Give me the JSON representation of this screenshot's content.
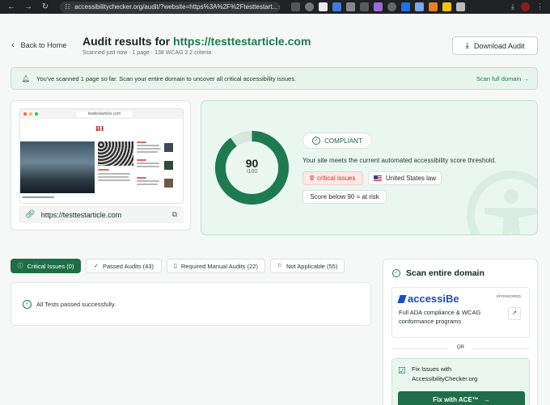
{
  "browser": {
    "url": "accessibilitychecker.org/audit/?website=https%3A%2F%2Ftesttestart..."
  },
  "header": {
    "back_label": "Back to Home",
    "title_prefix": "Audit results for ",
    "title_site": "https://testtestarticle.com",
    "subtitle": "Scanned just now · 1 page · 138 WCAG 2.2 criteria",
    "download_label": "Download Audit"
  },
  "banner": {
    "text": "You've scanned 1 page so far. Scan your entire domain to uncover all critical accessibility issues.",
    "link": "Scan full domain →"
  },
  "preview": {
    "mini_url": "testtestarticle.com",
    "link": "https://testtestarticle.com"
  },
  "score": {
    "value": "90",
    "max": "/100",
    "fraction": 0.9,
    "status": "COMPLIANT",
    "description": "Your site meets the current automated accessibility score threshold.",
    "critical_count": "0",
    "critical_label": "critical issues",
    "law": "United States law",
    "risk_note": "Score below 90 = at risk",
    "colors": {
      "ring": "#1f7a4f",
      "ring_track": "#d9e6de"
    }
  },
  "tabs": [
    {
      "label": "Critical Issues (0)",
      "icon": "info-icon",
      "active": true
    },
    {
      "label": "Passed Audits (43)",
      "icon": "check-icon",
      "active": false
    },
    {
      "label": "Required Manual Audits (22)",
      "icon": "document-icon",
      "active": false
    },
    {
      "label": "Not Applicable (55)",
      "icon": "flag-icon",
      "active": false
    }
  ],
  "results": {
    "message": "All Tests passed successfully."
  },
  "side": {
    "title": "Scan entire domain",
    "ad": {
      "brand": "accessiBe",
      "sponsored": "SPONSORED",
      "text": "Full ADA compliance & WCAG conformance programs"
    },
    "or": "OR",
    "fix": {
      "line1": "Fix Issues with",
      "line2": "AccessibilityChecker.org",
      "button": "Fix with ACE™"
    }
  }
}
